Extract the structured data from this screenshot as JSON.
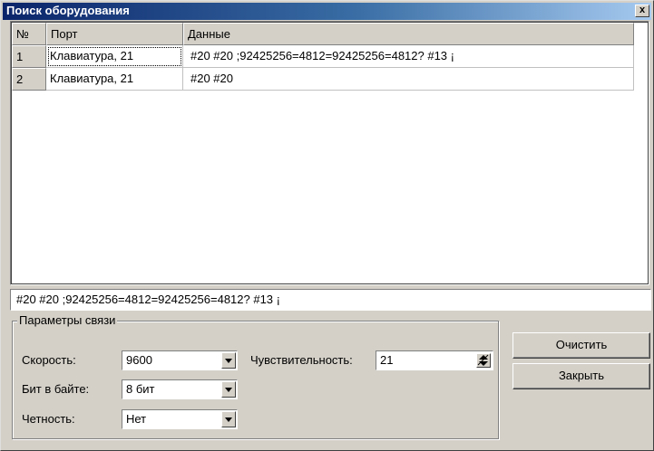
{
  "window": {
    "title": "Поиск оборудования",
    "close_glyph": "x"
  },
  "grid": {
    "columns": [
      "№",
      "Порт",
      "Данные"
    ],
    "rows": [
      {
        "num": "1",
        "port": "Клавиатура, 21",
        "data": "#20  #20 ;92425256=4812=92425256=4812? #13 ¡"
      },
      {
        "num": "2",
        "port": "Клавиатура, 21",
        "data": "#20  #20"
      }
    ]
  },
  "detail": {
    "text": "#20  #20 ;92425256=4812=92425256=4812? #13 ¡"
  },
  "params": {
    "legend": "Параметры связи",
    "speed_label": "Скорость:",
    "speed_value": "9600",
    "bits_label": "Бит в байте:",
    "bits_value": "8 бит",
    "parity_label": "Четность:",
    "parity_value": "Нет",
    "sensitivity_label": "Чувствительность:",
    "sensitivity_value": "21"
  },
  "buttons": {
    "clear": "Очистить",
    "close": "Закрыть"
  }
}
